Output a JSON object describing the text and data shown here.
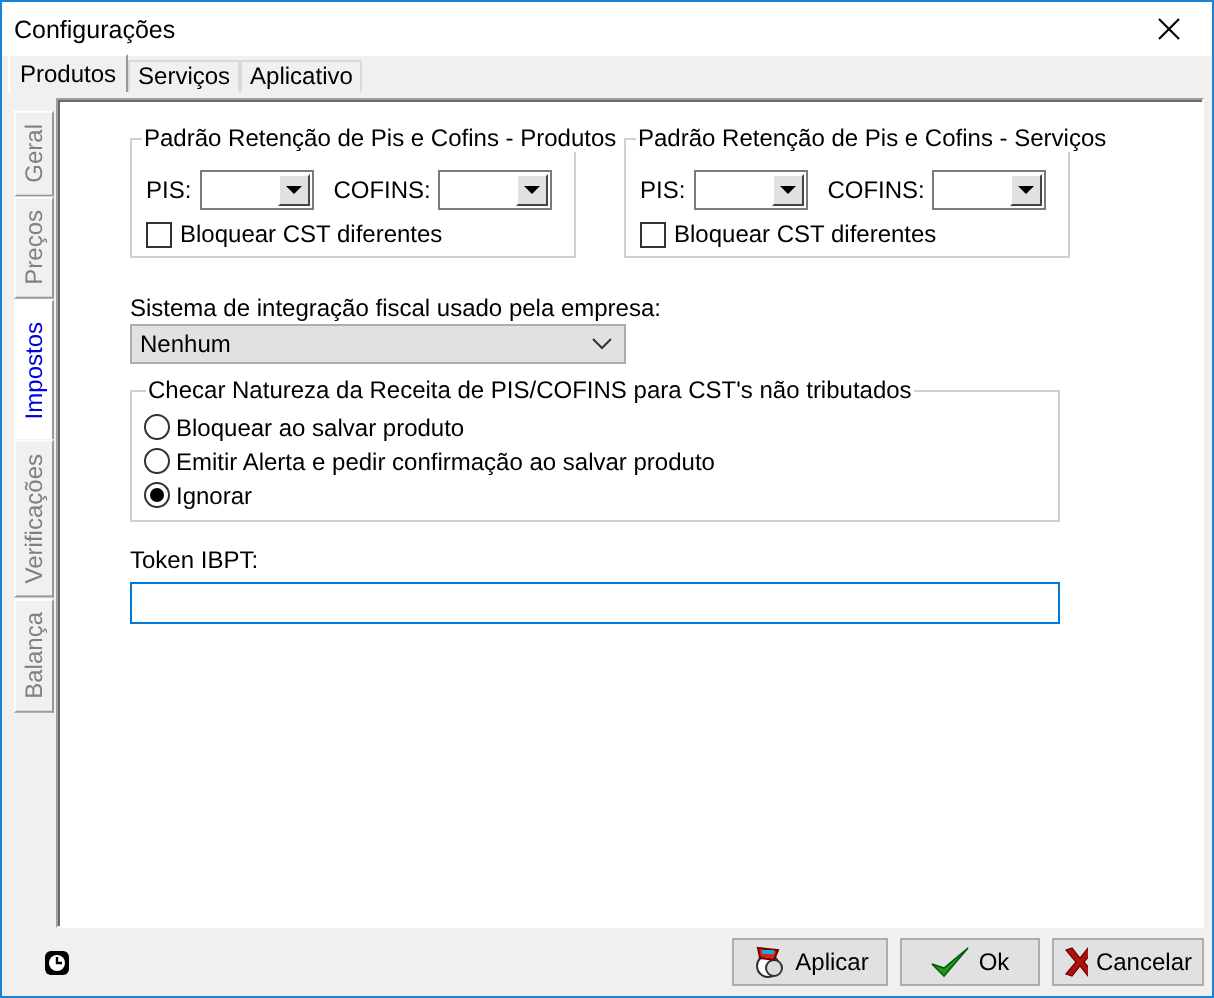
{
  "window": {
    "title": "Configurações"
  },
  "tabs": [
    {
      "label": "Produtos",
      "selected": true
    },
    {
      "label": "Serviços",
      "selected": false
    },
    {
      "label": "Aplicativo",
      "selected": false
    }
  ],
  "side_tabs": [
    {
      "label": "Geral",
      "selected": false
    },
    {
      "label": "Preços",
      "selected": false
    },
    {
      "label": "Impostos",
      "selected": true
    },
    {
      "label": "Verificações",
      "selected": false
    },
    {
      "label": "Balança",
      "selected": false
    }
  ],
  "retention_groups": [
    {
      "title": "Padrão Retenção de Pis e Cofins - Produtos",
      "pis_label": "PIS:",
      "cofins_label": "COFINS:",
      "checkbox": {
        "label": "Bloquear CST diferentes",
        "checked": false
      }
    },
    {
      "title": "Padrão Retenção de Pis e Cofins - Serviços",
      "pis_label": "PIS:",
      "cofins_label": "COFINS:",
      "checkbox": {
        "label": "Bloquear CST diferentes",
        "checked": false
      }
    }
  ],
  "integration": {
    "label": "Sistema de integração fiscal usado pela empresa:",
    "value": "Nenhum"
  },
  "natureza": {
    "title": "Checar Natureza da Receita de PIS/COFINS para CST's não tributados",
    "options": [
      {
        "label": "Bloquear ao salvar produto",
        "selected": false
      },
      {
        "label": "Emitir Alerta e pedir confirmação ao salvar produto",
        "selected": false
      },
      {
        "label": "Ignorar",
        "selected": true
      }
    ]
  },
  "token": {
    "label": "Token IBPT:"
  },
  "buttons": [
    {
      "label": "Aplicar",
      "kind": "apply"
    },
    {
      "label": "Ok",
      "kind": "ok"
    },
    {
      "label": "Cancelar",
      "kind": "cancel"
    }
  ]
}
